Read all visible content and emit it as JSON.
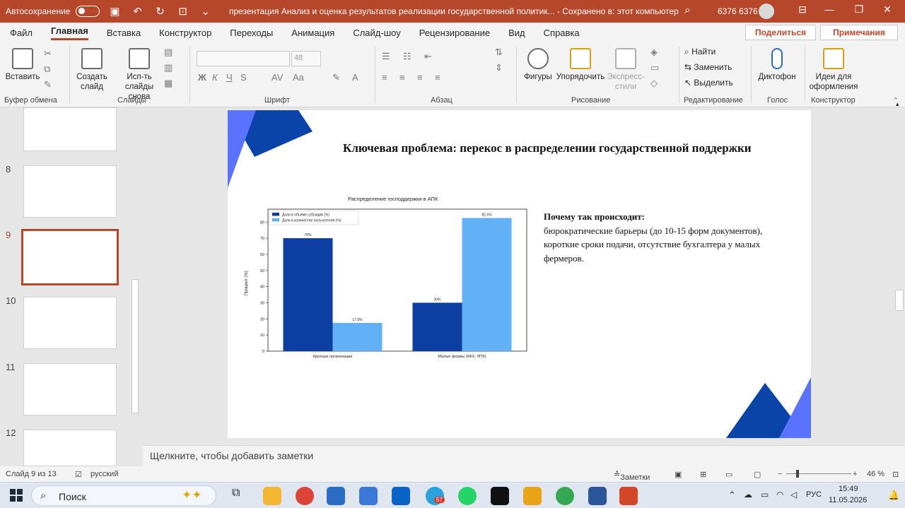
{
  "titlebar": {
    "autosave_label": "Автосохранение",
    "doc_title": "презентация Анализ и оценка результатов реализации государственной политик...  -  Сохранено в: этот компьютер",
    "user": "6376 6376"
  },
  "ribbon_tabs": [
    "Файл",
    "Главная",
    "Вставка",
    "Конструктор",
    "Переходы",
    "Анимация",
    "Слайд-шоу",
    "Рецензирование",
    "Вид",
    "Справка"
  ],
  "actions": {
    "share": "Поделиться",
    "comments": "Примечания"
  },
  "ribbon": {
    "paste": "Вставить",
    "new_slide": "Создать слайд",
    "reuse": "Исп-ть слайды снова",
    "font_size": "48",
    "shapes": "Фигуры",
    "arrange": "Упорядочить",
    "styles": "Экспресс-стили",
    "find": "Найти",
    "replace": "Заменить",
    "select": "Выделить",
    "dictate": "Диктофон",
    "designer": "Идеи для оформления",
    "groups": {
      "clipboard": "Буфер обмена",
      "slides": "Слайды",
      "font": "Шрифт",
      "paragraph": "Абзац",
      "drawing": "Рисование",
      "editing": "Редактирование",
      "voice": "Голос",
      "designer": "Конструктор"
    }
  },
  "thumbnails": [
    {
      "num": "8"
    },
    {
      "num": "9"
    },
    {
      "num": "10"
    },
    {
      "num": "11"
    },
    {
      "num": "12"
    }
  ],
  "slide": {
    "title": "Ключевая проблема: перекос в распределении государственной поддержки",
    "body_heading": "Почему так происходит:",
    "body_text": "бюрократические барьеры (до 10-15 форм документов), короткие сроки подачи, отсутствие бухгалтера у малых фермеров.",
    "accent_dark": "#0b44a8",
    "accent_light": "#5a73ff"
  },
  "chart_data": {
    "type": "bar",
    "title": "Распределение господдержки в АПК",
    "ylabel": "Процент (%)",
    "categories": [
      "Крупные организации",
      "Малые формы (КФХ, ЛПХ)"
    ],
    "series": [
      {
        "name": "Доля в объеме субсидий (%)",
        "values": [
          70,
          30
        ],
        "labels": [
          "70%",
          "30%"
        ],
        "color": "#0d3fa3"
      },
      {
        "name": "Доля в количестве получателей (%)",
        "values": [
          17.5,
          82.5
        ],
        "labels": [
          "17.5%",
          "82.5%"
        ],
        "color": "#62b0f5"
      }
    ],
    "yticks": [
      "0",
      "10",
      "20",
      "30",
      "40",
      "50",
      "60",
      "70",
      "80"
    ],
    "ylim": [
      0,
      88
    ],
    "legend": "top-left",
    "grid": false
  },
  "notes_placeholder": "Щелкните, чтобы добавить заметки",
  "status": {
    "slide_info": "Слайд 9 из 13",
    "language": "русский",
    "notes_btn": "Заметки",
    "zoom": "46 %"
  },
  "taskbar": {
    "search": "Поиск",
    "lang": "РУС",
    "time": "15:49",
    "date": "11.05.2026",
    "telegram_badge": "57"
  }
}
